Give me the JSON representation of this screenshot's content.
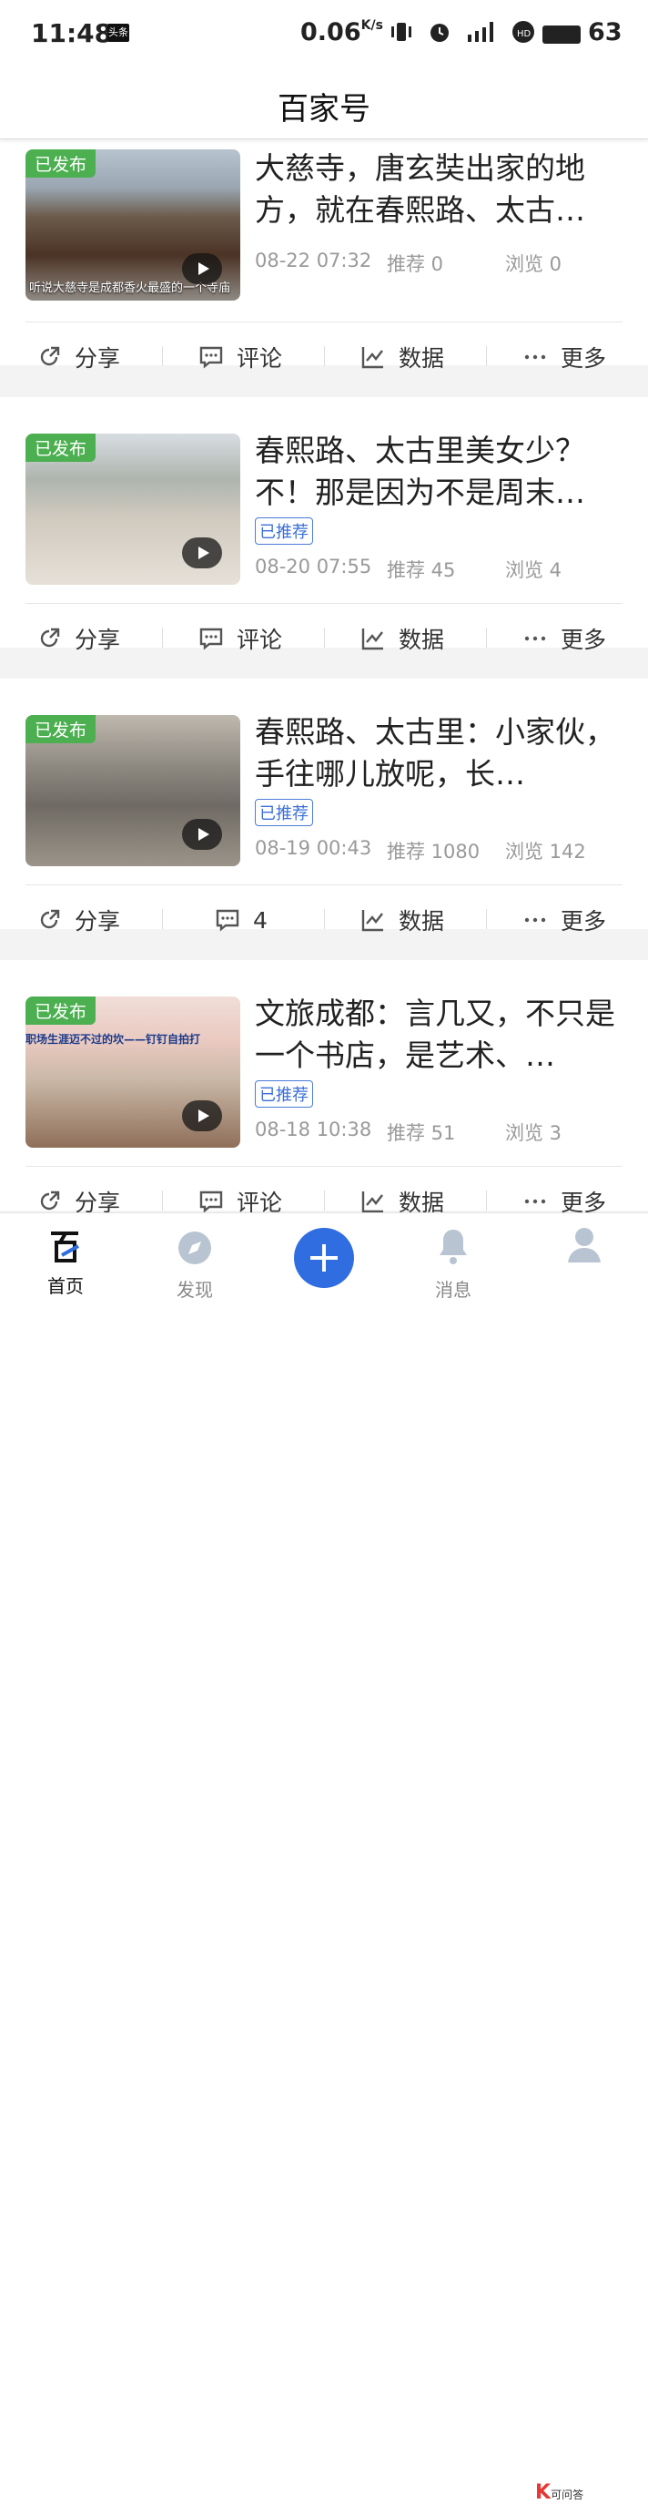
{
  "status": {
    "time": "11:48",
    "app_icon": "头条",
    "speed": "0.06",
    "speed_unit": "K/s",
    "battery": "63",
    "icons": [
      "vibrate-icon",
      "alarm-icon",
      "signal-4g-icon",
      "hd-icon",
      "battery-icon"
    ]
  },
  "nav": {
    "title": "百家号"
  },
  "cards": [
    {
      "badge": "已发布",
      "caption": "听说大慈寺是成都香火最盛的一个寺庙",
      "title": "大慈寺，唐玄奘出家的地方，就在春熙路、太古…",
      "recommended": "",
      "date": "08-22 07:32",
      "rec_count": "推荐 0",
      "views": "浏览 0",
      "share": "分享",
      "comment": "评论",
      "data": "数据",
      "more": "更多"
    },
    {
      "badge": "已发布",
      "caption": "",
      "title": "春熙路、太古里美女少？不！那是因为不是周末…",
      "recommended": "已推荐",
      "date": "08-20 07:55",
      "rec_count": "推荐 45",
      "views": "浏览 4",
      "share": "分享",
      "comment": "评论",
      "data": "数据",
      "more": "更多"
    },
    {
      "badge": "已发布",
      "caption": "",
      "title": "春熙路、太古里：小家伙，手往哪儿放呢，长…",
      "recommended": "已推荐",
      "date": "08-19 00:43",
      "rec_count": "推荐 1080",
      "views": "浏览 142",
      "share": "分享",
      "comment": "4",
      "data": "数据",
      "more": "更多"
    },
    {
      "badge": "已发布",
      "caption": "",
      "title": "文旅成都：言几又，不只是一个书店，是艺术、…",
      "recommended": "已推荐",
      "date": "08-18 10:38",
      "rec_count": "推荐 51",
      "views": "浏览 3",
      "share": "分享",
      "comment": "评论",
      "data": "数据",
      "more": "更多"
    }
  ],
  "thumb_text": {
    "book_banner": "职场生涯迈不过的坎——钉钉自拍打"
  },
  "tabs": [
    {
      "label": "首页",
      "icon": "baijiahao-logo-icon",
      "active": true
    },
    {
      "label": "发现",
      "icon": "compass-icon",
      "active": false
    },
    {
      "label": "",
      "icon": "plus-icon",
      "active": false
    },
    {
      "label": "消息",
      "icon": "bell-icon",
      "active": false
    },
    {
      "label": "",
      "icon": "profile-icon",
      "active": false
    }
  ],
  "watermark": "可问答",
  "colors": {
    "accent": "#2f6de1",
    "badge": "#4caf50",
    "recommended": "#3b6fd8"
  }
}
